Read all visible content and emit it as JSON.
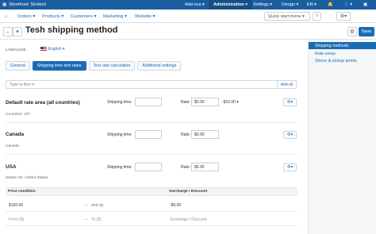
{
  "topbar": {
    "store_name": "Storefront: Simtech",
    "addons": "Add-ons",
    "administration": "Administration",
    "settings": "Settings",
    "design": "Design",
    "language": "EN",
    "notifications_icon": "bell-icon",
    "user_icon": "user-icon"
  },
  "navbar": {
    "items": [
      "Orders",
      "Products",
      "Customers",
      "Marketing",
      "Website"
    ],
    "quick_start": "Quick start menu"
  },
  "header": {
    "title": "Tesh shipping method",
    "save_label": "Save"
  },
  "sidebar": {
    "items": [
      "Shipping methods",
      "Rate areas",
      "Stores & pickup points"
    ]
  },
  "language_label": "LANGUAGE",
  "language_value": "English",
  "tabs": [
    "General",
    "Shipping time and rates",
    "Test rate calculation",
    "Additional settings"
  ],
  "type_input": {
    "placeholder": "Type to filter",
    "add_all": "Add all"
  },
  "rate_areas": [
    {
      "name": "Default rate area (all countries)",
      "shipping_time_label": "Shipping time:",
      "rate_label": "Rate:",
      "rate_value": "$0.00",
      "extra": "-$10.00",
      "countries": "Countries: 237"
    },
    {
      "name": "Canada",
      "shipping_time_label": "Shipping time:",
      "rate_label": "Rate:",
      "rate_value": "$0.00",
      "countries": "Canada"
    },
    {
      "name": "USA",
      "shipping_time_label": "Shipping time:",
      "rate_label": "Rate:",
      "rate_value": "$5.00",
      "countries": "States: 54, United States"
    }
  ],
  "table": {
    "headers": [
      "Price condition",
      "Surcharge / Discount"
    ],
    "rows": [
      {
        "from": "$100.00",
        "dash": "—",
        "to": "and up",
        "surcharge": "-$5.00"
      },
      {
        "from": "From ($)",
        "dash": "—",
        "to": "To ($)",
        "surcharge": "Surcharge / Discount"
      }
    ]
  },
  "colors": {
    "brand": "#1a5ea0",
    "accent": "#1a6cb5"
  }
}
